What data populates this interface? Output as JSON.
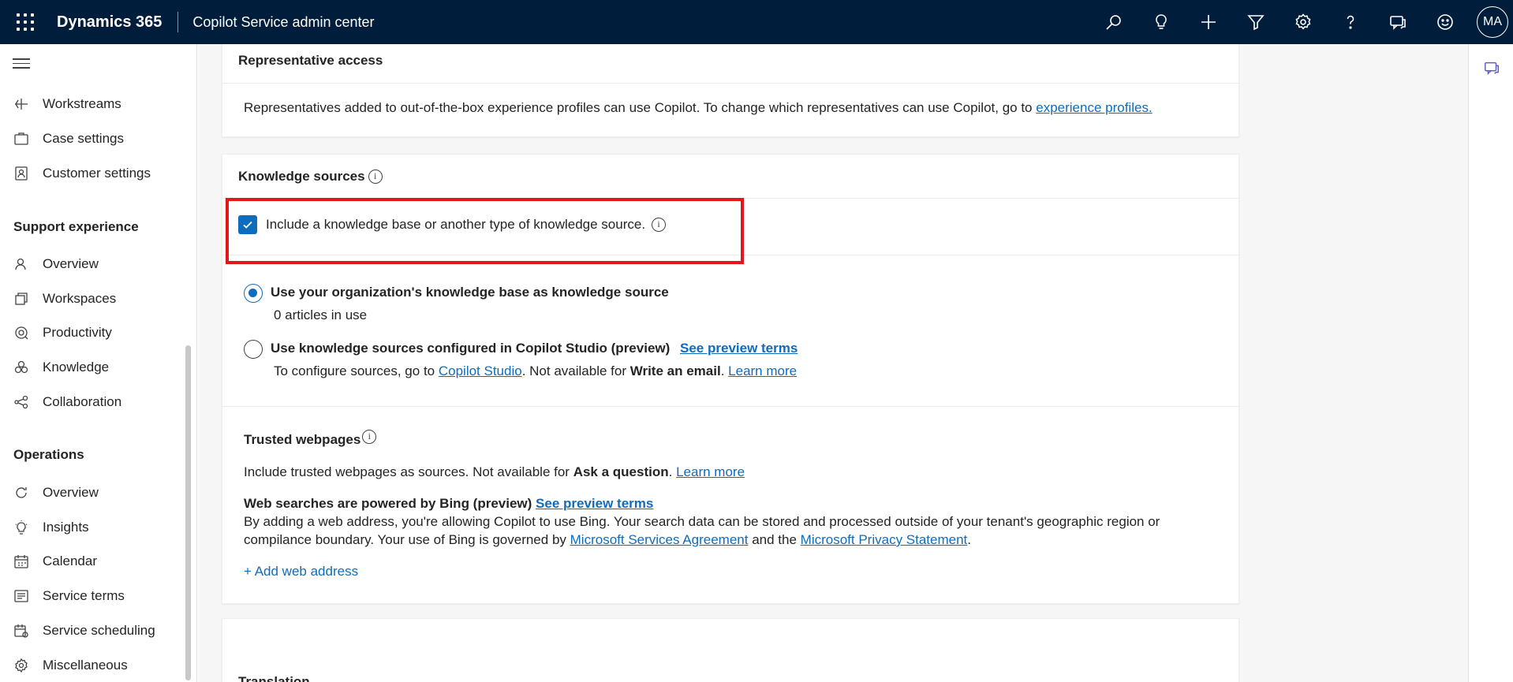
{
  "header": {
    "brand": "Dynamics 365",
    "app_name": "Copilot Service admin center",
    "icons": [
      "search-icon",
      "lightbulb-icon",
      "add-icon",
      "filter-icon",
      "settings-icon",
      "help-icon",
      "chat-icon",
      "smiley-icon"
    ],
    "avatar_initials": "MA"
  },
  "sidebar": {
    "items_top": [
      {
        "label": "Workstreams",
        "icon": "workstreams-icon"
      },
      {
        "label": "Case settings",
        "icon": "case-icon"
      },
      {
        "label": "Customer settings",
        "icon": "customer-icon"
      }
    ],
    "section_support": "Support experience",
    "items_support": [
      {
        "label": "Overview",
        "icon": "person-icon"
      },
      {
        "label": "Workspaces",
        "icon": "workspaces-icon"
      },
      {
        "label": "Productivity",
        "icon": "productivity-icon"
      },
      {
        "label": "Knowledge",
        "icon": "knowledge-icon"
      },
      {
        "label": "Collaboration",
        "icon": "collaboration-icon"
      }
    ],
    "section_operations": "Operations",
    "items_operations": [
      {
        "label": "Overview",
        "icon": "refresh-icon"
      },
      {
        "label": "Insights",
        "icon": "insights-icon"
      },
      {
        "label": "Calendar",
        "icon": "calendar-icon"
      },
      {
        "label": "Service terms",
        "icon": "service-terms-icon"
      },
      {
        "label": "Service scheduling",
        "icon": "scheduling-icon"
      },
      {
        "label": "Miscellaneous",
        "icon": "gear-icon"
      }
    ]
  },
  "rep_access": {
    "title": "Representative access",
    "text": "Representatives added to out-of-the-box experience profiles can use Copilot. To change which representatives can use Copilot, go to",
    "link": "experience profiles."
  },
  "knowledge": {
    "title": "Knowledge sources",
    "include_checkbox_label": "Include a knowledge base or another type of knowledge source.",
    "include_checked": true,
    "option1_label": "Use your organization's knowledge base as knowledge source",
    "option1_sub": "0 articles in use",
    "option1_selected": true,
    "option2_label": "Use knowledge sources configured in Copilot Studio (preview)",
    "option2_link": "See preview terms",
    "option2_sub_pre": "To configure sources, go to",
    "option2_sub_link": "Copilot Studio",
    "option2_sub_mid": ". Not available for",
    "option2_sub_bold": "Write an email",
    "option2_sub_dot": ".",
    "option2_learn_more": "Learn more",
    "trusted_title": "Trusted webpages",
    "trusted_text_pre": "Include trusted webpages as sources. Not available for",
    "trusted_text_bold": "Ask a question",
    "trusted_text_dot": ".",
    "trusted_learn_more": "Learn more",
    "bing_title": "Web searches are powered by Bing (preview)",
    "bing_link": "See preview terms",
    "bing_line1": "By adding a web address, you're allowing Copilot to use Bing. Your search data can be stored and processed outside of your tenant's geographic region or",
    "bing_line2_pre": "compilance boundary. Your use of Bing is governed by",
    "bing_link_msa": "Microsoft Services Agreement",
    "bing_line2_mid": "and the",
    "bing_link_privacy": "Microsoft Privacy Statement",
    "bing_line2_end": ".",
    "add_web": "+ Add web address"
  },
  "translation": {
    "title": "Translation"
  },
  "colors": {
    "header_bg": "#001e3c",
    "accent": "#0f6cbd",
    "highlight": "#e8141c"
  }
}
